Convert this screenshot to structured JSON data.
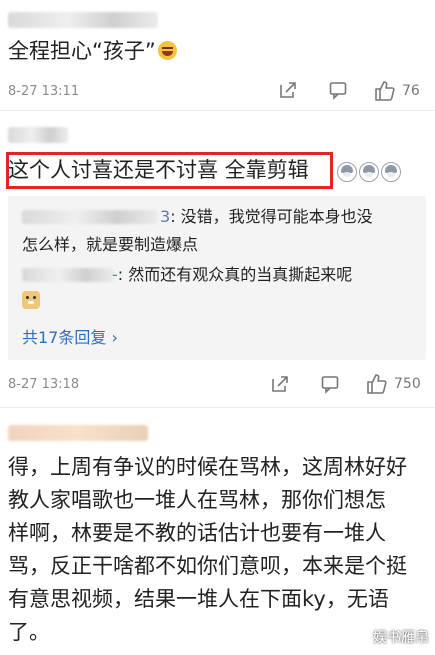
{
  "comments": [
    {
      "text": "全程担心“孩子”",
      "emoji": "laughing-tears-icon",
      "time": "8-27 13:11",
      "likes": "76"
    },
    {
      "text": "这个人讨喜还是不讨喜  全靠剪辑",
      "emoji": "husky-icon",
      "time": "8-27 13:18",
      "likes": "750",
      "replies": [
        {
          "name": "小",
          "suffix": "3",
          "text": ": 没错，我觉得可能本身也没"
        },
        {
          "text_cont": "怎么样，就是要制造爆点"
        },
        {
          "name": "",
          "suffix": "-",
          "text": ": 然而还有观众真的当真撕起来呢"
        }
      ],
      "reply_emoji": "doge-icon",
      "more_replies": "共17条回复 ›"
    },
    {
      "lines": [
        "得，上周有争议的时候在骂林，这周林好好",
        "教人家唱歌也一堆人在骂林，那你们想怎",
        "样啊，林要是不教的话估计也要有一堆人",
        "骂，反正干啥都不如你们意呗，本来是个挺",
        "有意思视频，结果一堆人在下面ky，无语",
        "了。"
      ]
    }
  ],
  "icons": {
    "share": "share-icon",
    "comment": "comment-icon",
    "like": "like-icon"
  },
  "watermark": "娱书雁帛",
  "colors": {
    "highlight": "#e02525",
    "link": "#2f6fb8",
    "reply_name": "#5b7fb0"
  }
}
